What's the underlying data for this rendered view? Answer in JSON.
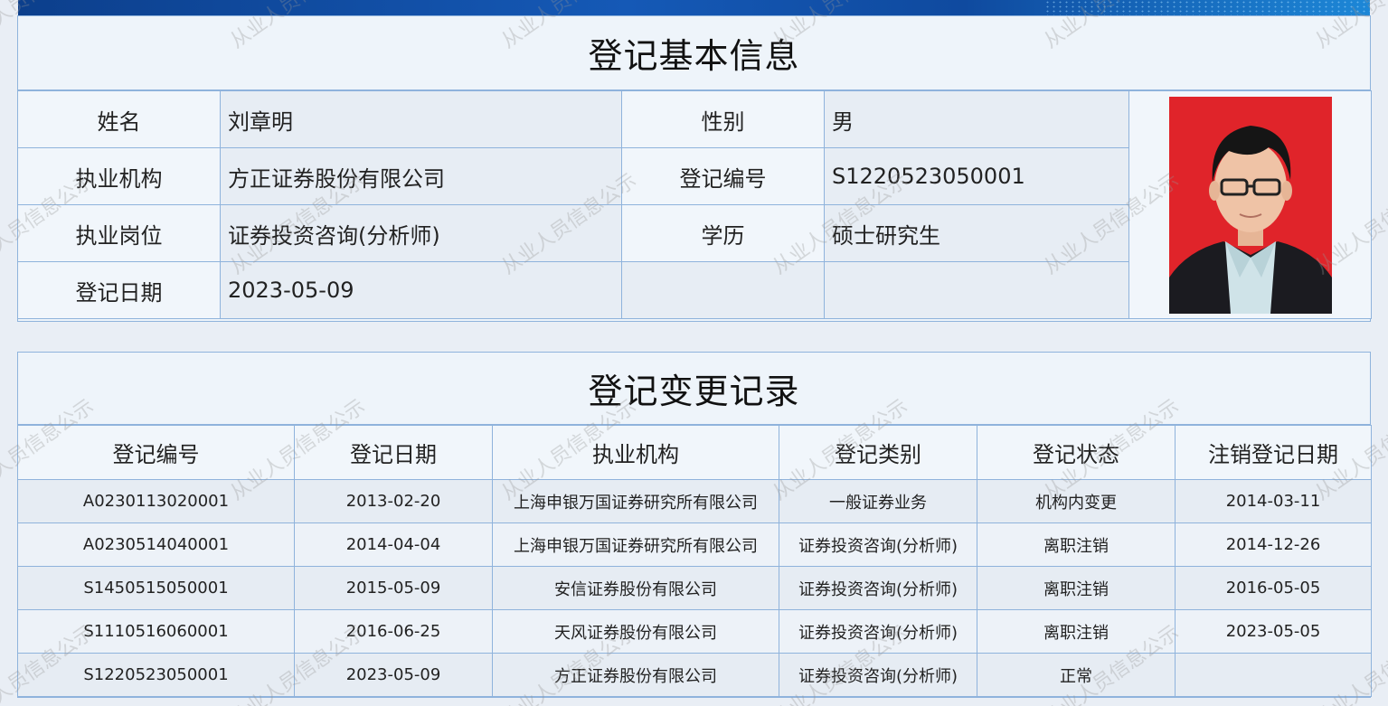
{
  "basic_info": {
    "title": "登记基本信息",
    "rows": [
      {
        "label1": "姓名",
        "value1": "刘章明",
        "label2": "性别",
        "value2": "男"
      },
      {
        "label1": "执业机构",
        "value1": "方正证券股份有限公司",
        "label2": "登记编号",
        "value2": "S1220523050001"
      },
      {
        "label1": "执业岗位",
        "value1": "证券投资咨询(分析师)",
        "label2": "学历",
        "value2": "硕士研究生"
      },
      {
        "label1": "登记日期",
        "value1": "2023-05-09",
        "label2": "",
        "value2": ""
      }
    ]
  },
  "change_records": {
    "title": "登记变更记录",
    "headers": [
      "登记编号",
      "登记日期",
      "执业机构",
      "登记类别",
      "登记状态",
      "注销登记日期"
    ],
    "rows": [
      [
        "A0230113020001",
        "2013-02-20",
        "上海申银万国证券研究所有限公司",
        "一般证券业务",
        "机构内变更",
        "2014-03-11"
      ],
      [
        "A0230514040001",
        "2014-04-04",
        "上海申银万国证券研究所有限公司",
        "证券投资咨询(分析师)",
        "离职注销",
        "2014-12-26"
      ],
      [
        "S1450515050001",
        "2015-05-09",
        "安信证券股份有限公司",
        "证券投资咨询(分析师)",
        "离职注销",
        "2016-05-05"
      ],
      [
        "S1110516060001",
        "2016-06-25",
        "天风证券股份有限公司",
        "证券投资咨询(分析师)",
        "离职注销",
        "2023-05-05"
      ],
      [
        "S1220523050001",
        "2023-05-09",
        "方正证券股份有限公司",
        "证券投资咨询(分析师)",
        "正常",
        ""
      ]
    ]
  },
  "watermark": "从业人员信息公示",
  "colors": {
    "border": "#8fb3dc",
    "photo_background": "#e0242a",
    "banner": "#1559b6"
  }
}
